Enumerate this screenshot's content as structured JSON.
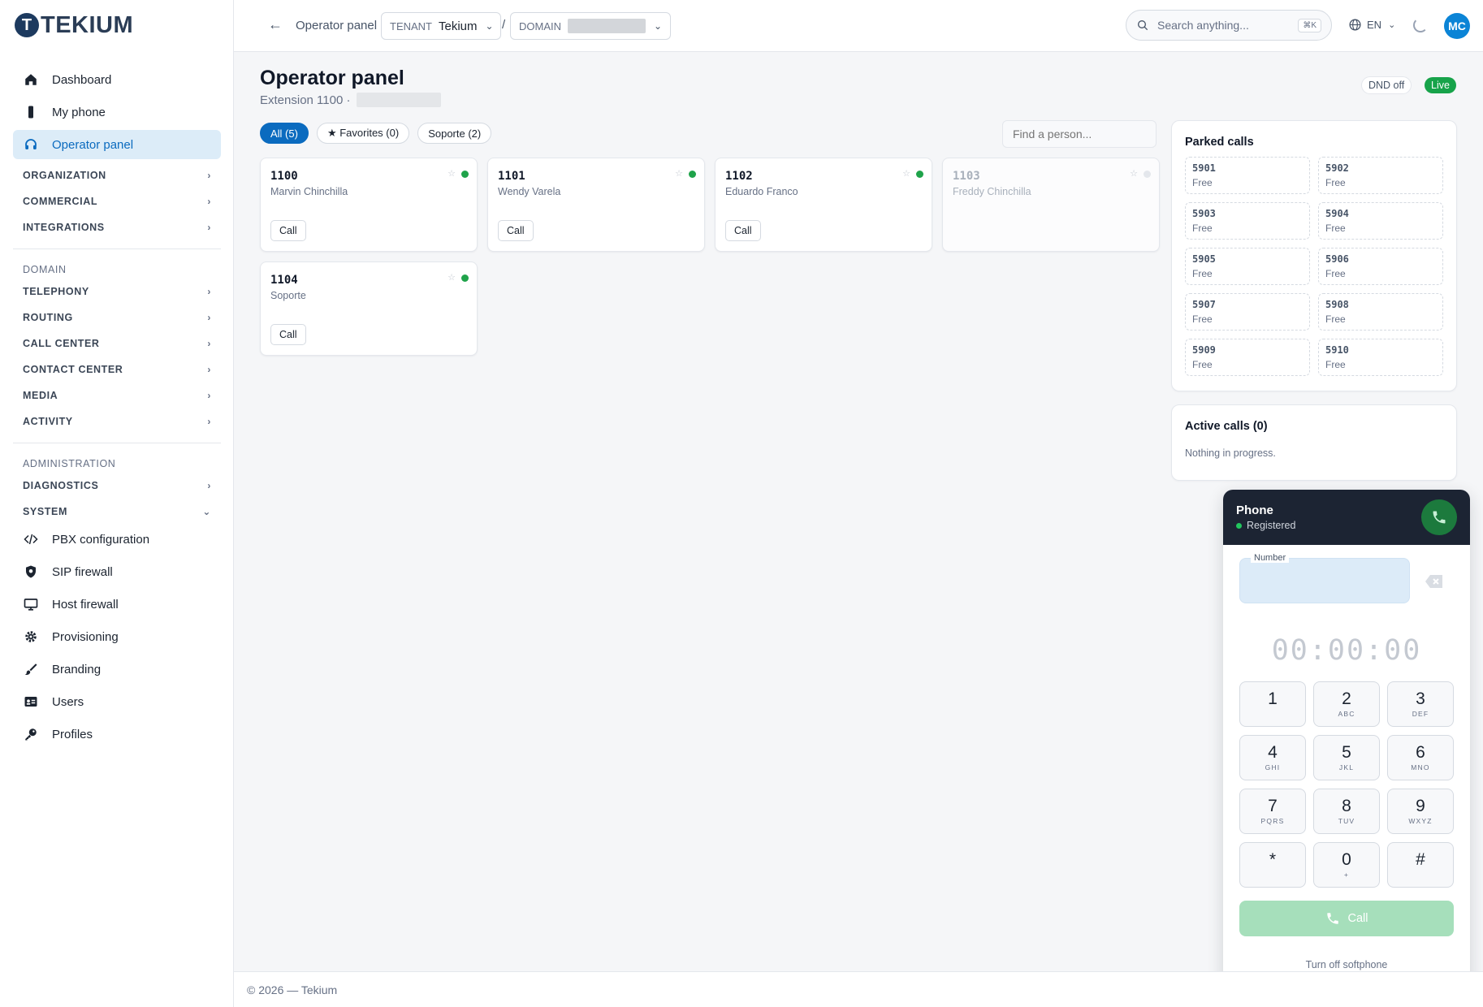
{
  "app": {
    "logo_text": "TEKIUM"
  },
  "sidebar": {
    "top_items": [
      {
        "label": "Dashboard"
      },
      {
        "label": "My phone"
      },
      {
        "label": "Operator panel"
      }
    ],
    "groups_1": [
      "ORGANIZATION",
      "COMMERCIAL",
      "INTEGRATIONS"
    ],
    "domain_label": "DOMAIN",
    "groups_2": [
      "TELEPHONY",
      "ROUTING",
      "CALL CENTER",
      "CONTACT CENTER",
      "MEDIA",
      "ACTIVITY"
    ],
    "admin_label": "ADMINISTRATION",
    "groups_3": [
      "DIAGNOSTICS",
      "SYSTEM"
    ],
    "system_items": [
      {
        "label": "PBX configuration"
      },
      {
        "label": "SIP firewall"
      },
      {
        "label": "Host firewall"
      },
      {
        "label": "Provisioning"
      },
      {
        "label": "Branding"
      },
      {
        "label": "Users"
      },
      {
        "label": "Profiles"
      }
    ]
  },
  "topbar": {
    "crumb": "Operator panel",
    "tenant_label": "TENANT",
    "tenant_value": "Tekium",
    "separator": "/",
    "domain_label": "DOMAIN",
    "search_placeholder": "Search anything...",
    "search_shortcut": "⌘K",
    "language": "EN",
    "avatar_initials": "MC"
  },
  "page": {
    "title": "Operator panel",
    "subtitle": "Extension 1100 ·",
    "dnd": "DND off",
    "live": "Live"
  },
  "filters": [
    {
      "label": "All (5)",
      "active": true
    },
    {
      "label": "★ Favorites (0)",
      "active": false
    },
    {
      "label": "Soporte (2)",
      "active": false
    }
  ],
  "find_placeholder": "Find a person...",
  "extensions": [
    {
      "ext": "1100",
      "name": "Marvin Chinchilla",
      "online": true,
      "action": "Call"
    },
    {
      "ext": "1101",
      "name": "Wendy Varela",
      "online": true,
      "action": "Call"
    },
    {
      "ext": "1102",
      "name": "Eduardo Franco",
      "online": true,
      "action": "Call"
    },
    {
      "ext": "1103",
      "name": "Freddy Chinchilla",
      "online": false,
      "action": ""
    },
    {
      "ext": "1104",
      "name": "Soporte",
      "online": true,
      "action": "Call"
    }
  ],
  "parked": {
    "title": "Parked calls",
    "slots": [
      {
        "num": "5901",
        "status": "Free"
      },
      {
        "num": "5902",
        "status": "Free"
      },
      {
        "num": "5903",
        "status": "Free"
      },
      {
        "num": "5904",
        "status": "Free"
      },
      {
        "num": "5905",
        "status": "Free"
      },
      {
        "num": "5906",
        "status": "Free"
      },
      {
        "num": "5907",
        "status": "Free"
      },
      {
        "num": "5908",
        "status": "Free"
      },
      {
        "num": "5909",
        "status": "Free"
      },
      {
        "num": "5910",
        "status": "Free"
      }
    ]
  },
  "active_calls": {
    "title": "Active calls (0)",
    "empty": "Nothing in progress."
  },
  "phone": {
    "title": "Phone",
    "status": "Registered",
    "number_label": "Number",
    "timer": "00:00:00",
    "keys": [
      {
        "d": "1",
        "l": ""
      },
      {
        "d": "2",
        "l": "ABC"
      },
      {
        "d": "3",
        "l": "DEF"
      },
      {
        "d": "4",
        "l": "GHI"
      },
      {
        "d": "5",
        "l": "JKL"
      },
      {
        "d": "6",
        "l": "MNO"
      },
      {
        "d": "7",
        "l": "PQRS"
      },
      {
        "d": "8",
        "l": "TUV"
      },
      {
        "d": "9",
        "l": "WXYZ"
      },
      {
        "d": "*",
        "l": ""
      },
      {
        "d": "0",
        "l": "+"
      },
      {
        "d": "#",
        "l": ""
      }
    ],
    "call_label": "Call",
    "turn_off": "Turn off softphone"
  },
  "colors": {
    "accent": "#0b6bbf",
    "online": "#1fa34a",
    "live": "#17a34a",
    "phone_header": "#1c2433"
  },
  "footer": {
    "text": "© 2026 — Tekium"
  }
}
